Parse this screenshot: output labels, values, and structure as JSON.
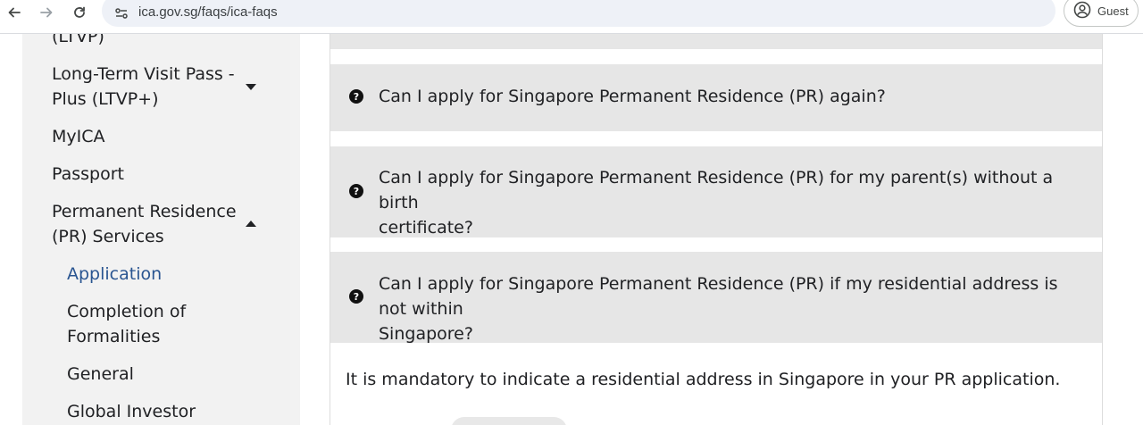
{
  "browser": {
    "url": "ica.gov.sg/faqs/ica-faqs",
    "profile_label": "Guest"
  },
  "sidebar": {
    "partial_top": "(LTVP)",
    "items": [
      {
        "label_line1": "Long-Term Visit Pass -",
        "label_line2": "Plus (LTVP+)",
        "expanded": false
      },
      {
        "label": "MyICA"
      },
      {
        "label": "Passport"
      },
      {
        "label_line1": "Permanent Residence",
        "label_line2": "(PR) Services",
        "expanded": true
      }
    ],
    "sub_items": [
      {
        "label": "Application",
        "active": true
      },
      {
        "label_line1": "Completion of",
        "label_line2": "Formalities"
      },
      {
        "label": "General"
      },
      {
        "label": "Global Investor"
      }
    ]
  },
  "faqs": [
    {
      "line1": "Can I apply for Singapore Permanent Residence (PR) again?"
    },
    {
      "line1": "Can I apply for Singapore Permanent Residence (PR) for my parent(s) without a birth",
      "line2": "certificate?"
    },
    {
      "line1": "Can I apply for Singapore Permanent Residence (PR) if my residential address is not within",
      "line2": "Singapore?"
    }
  ],
  "answer": "It is mandatory to indicate a residential address in Singapore in your PR application.",
  "colors": {
    "active_link": "#2a5591",
    "faq_bg": "#e6e6e6",
    "sidebar_bg": "#f2f2f2"
  }
}
